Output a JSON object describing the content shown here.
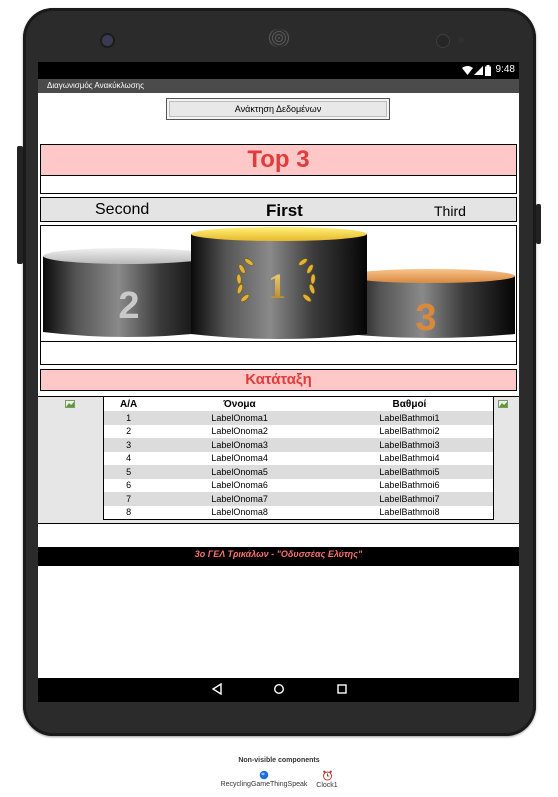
{
  "status_bar": {
    "time": "9:48"
  },
  "app": {
    "title": "Διαγωνισμός Ανακύκλωσης"
  },
  "fetch_button": {
    "label": "Ανάκτηση Δεδομένων"
  },
  "top3": {
    "heading": "Top 3",
    "second_label": "Second",
    "first_label": "First",
    "third_label": "Third",
    "podium_numbers": {
      "first": "1",
      "second": "2",
      "third": "3"
    }
  },
  "ranking": {
    "heading": "Κατάταξη",
    "headers": [
      "Α/Α",
      "Όνομα",
      "Βαθμοί"
    ],
    "rows": [
      [
        "1",
        "LabelOnoma1",
        "LabelBathmoi1"
      ],
      [
        "2",
        "LabelOnoma2",
        "LabelBathmoi2"
      ],
      [
        "3",
        "LabelOnoma3",
        "LabelBathmoi3"
      ],
      [
        "4",
        "LabelOnoma4",
        "LabelBathmoi4"
      ],
      [
        "5",
        "LabelOnoma5",
        "LabelBathmoi5"
      ],
      [
        "6",
        "LabelOnoma6",
        "LabelBathmoi6"
      ],
      [
        "7",
        "LabelOnoma7",
        "LabelBathmoi7"
      ],
      [
        "8",
        "LabelOnoma8",
        "LabelBathmoi8"
      ]
    ]
  },
  "footer": {
    "text": "3ο ΓΕΛ Τρικάλων - \"Οδυσσέας Ελύτης\""
  },
  "non_visible": {
    "title": "Non-visible components",
    "items": [
      {
        "label": "RecyclingGameThingSpeak",
        "icon": "web-component-icon"
      },
      {
        "label": "Clock1",
        "icon": "clock-icon"
      }
    ]
  },
  "colors": {
    "pink_bar": "#ffc8c8",
    "heading_red": "#e03c3c",
    "footer_text": "#ff7070",
    "gold": "#f2d33a",
    "bronze": "#e7a35e",
    "silver": "#d8d8d8"
  }
}
